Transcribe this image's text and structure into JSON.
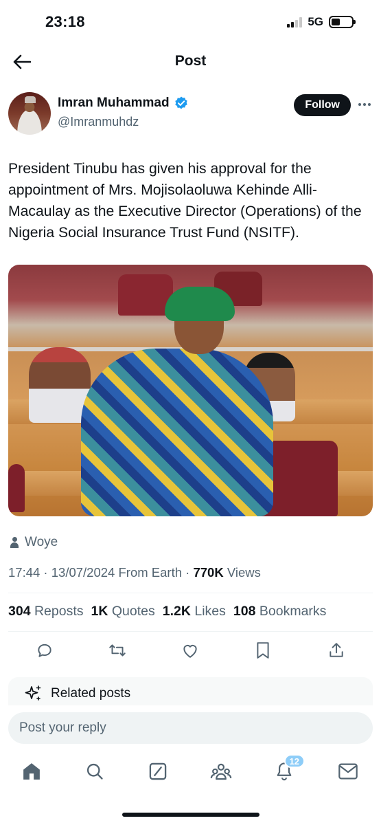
{
  "status_bar": {
    "time": "23:18",
    "network": "5G"
  },
  "header": {
    "title": "Post"
  },
  "author": {
    "display_name": "Imran Muhammad",
    "handle": "@Imranmuhdz",
    "verified": true,
    "follow_label": "Follow"
  },
  "post": {
    "text": "President Tinubu has given his approval for the appointment of Mrs. Mojisolaoluwa Kehinde Alli-Macaulay as the Executive Director (Operations) of the Nigeria Social Insurance Trust Fund (NSITF).",
    "location": "Woye",
    "time": "17:44",
    "date": "13/07/2024",
    "source": "From Earth",
    "views_count": "770K",
    "views_label": "Views"
  },
  "stats": [
    {
      "count": "304",
      "label": "Reposts"
    },
    {
      "count": "1K",
      "label": "Quotes"
    },
    {
      "count": "1.2K",
      "label": "Likes"
    },
    {
      "count": "108",
      "label": "Bookmarks"
    }
  ],
  "actions": [
    "reply-icon",
    "repost-icon",
    "like-icon",
    "bookmark-icon",
    "share-icon"
  ],
  "related": {
    "label": "Related posts"
  },
  "reply": {
    "placeholder": "Post your reply"
  },
  "bottom_nav": {
    "items": [
      "home-icon",
      "search-icon",
      "grok-icon",
      "communities-icon",
      "notifications-icon",
      "messages-icon"
    ],
    "notifications_badge": "12"
  },
  "colors": {
    "accent": "#1d9bf0",
    "text": "#0f1419",
    "muted": "#536471",
    "badge": "#8ecdf8"
  }
}
